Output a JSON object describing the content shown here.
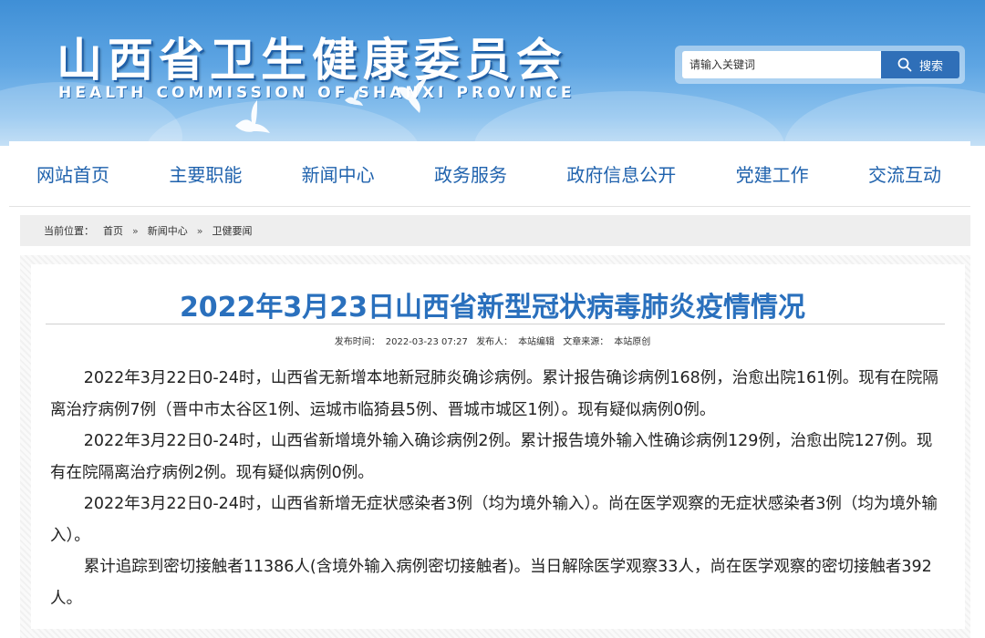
{
  "header": {
    "title_cn": "山西省卫生健康委员会",
    "title_en": "HEALTH COMMISSION OF SHANXI PROVINCE"
  },
  "search": {
    "placeholder": "请输入关键词",
    "button_label": "搜索"
  },
  "nav": {
    "items": [
      {
        "label": "网站首页"
      },
      {
        "label": "主要职能"
      },
      {
        "label": "新闻中心"
      },
      {
        "label": "政务服务"
      },
      {
        "label": "政府信息公开"
      },
      {
        "label": "党建工作"
      },
      {
        "label": "交流互动"
      }
    ]
  },
  "breadcrumb": {
    "prefix": "当前位置：",
    "items": [
      "首页",
      "新闻中心",
      "卫健要闻"
    ],
    "separator": "»"
  },
  "article": {
    "title": "2022年3月23日山西省新型冠状病毒肺炎疫情情况",
    "meta": {
      "publish_label": "发布时间：",
      "publish_time": "2022-03-23 07:27",
      "author_label": "发布人：",
      "author": "本站编辑",
      "source_label": "文章来源：",
      "source": "本站原创"
    },
    "paragraphs": [
      "2022年3月22日0-24时，山西省无新增本地新冠肺炎确诊病例。累计报告确诊病例168例，治愈出院161例。现有在院隔离治疗病例7例（晋中市太谷区1例、运城市临猗县5例、晋城市城区1例）。现有疑似病例0例。",
      "2022年3月22日0-24时，山西省新增境外输入确诊病例2例。累计报告境外输入性确诊病例129例，治愈出院127例。现有在院隔离治疗病例2例。现有疑似病例0例。",
      "2022年3月22日0-24时，山西省新增无症状感染者3例（均为境外输入）。尚在医学观察的无症状感染者3例（均为境外输入）。",
      "累计追踪到密切接触者11386人(含境外输入病例密切接触者)。当日解除医学观察33人，尚在医学观察的密切接触者392人。"
    ]
  },
  "colors": {
    "header_blue": "#3f8fd6",
    "nav_text": "#1f62ad",
    "title_blue": "#2a70bd",
    "search_button": "#2f6fb8"
  },
  "icons": {
    "search": "search-icon",
    "decoration": "dove-icon"
  }
}
